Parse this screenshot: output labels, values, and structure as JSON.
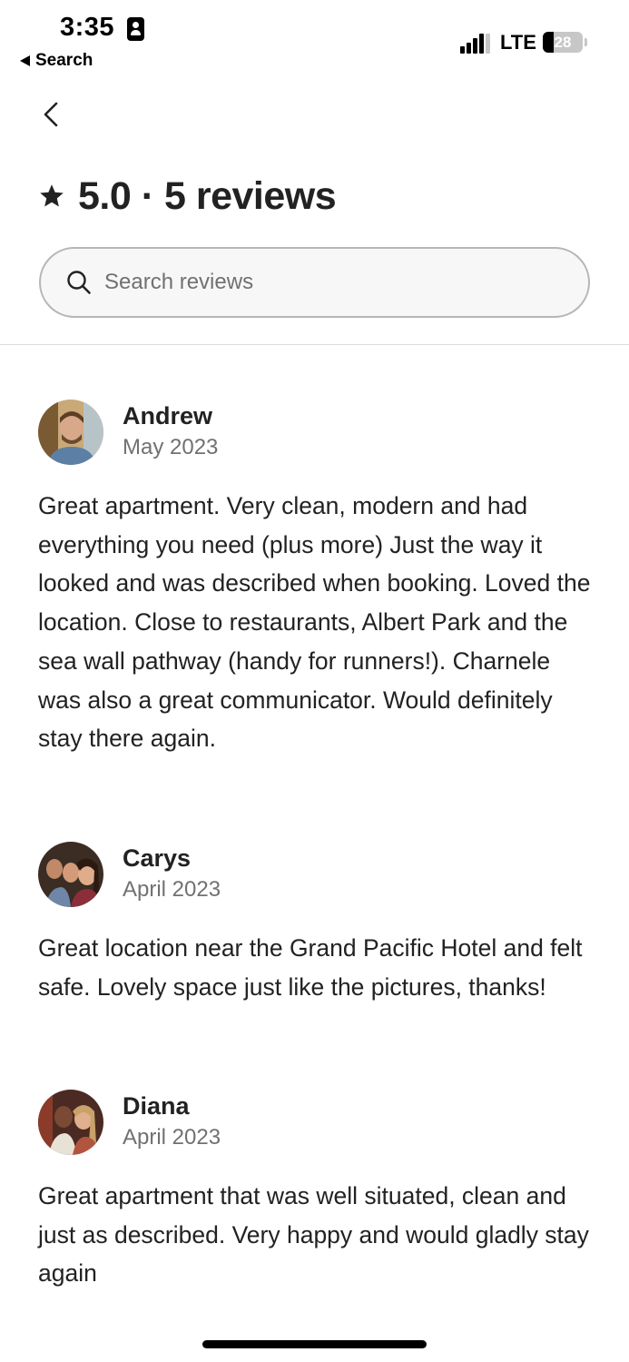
{
  "status_bar": {
    "time": "3:35",
    "back_app_label": "Search",
    "network": "LTE",
    "battery_percent": "28",
    "battery_level": 0.28
  },
  "header": {
    "rating": "5.0",
    "review_count_label": "5 reviews",
    "title": "5.0 · 5 reviews"
  },
  "search": {
    "placeholder": "Search reviews",
    "value": ""
  },
  "reviews": [
    {
      "name": "Andrew",
      "date": "May 2023",
      "text": "Great apartment. Very clean, modern and had everything you need (plus more) Just the way it looked and was described when booking. Loved the location. Close to  restaurants, Albert Park and the sea wall pathway (handy for runners!). Charnele was also a great communicator. Would definitely stay there again."
    },
    {
      "name": "Carys",
      "date": "April 2023",
      "text": "Great location near the Grand Pacific Hotel and felt safe. Lovely space just like the pictures, thanks!"
    },
    {
      "name": "Diana",
      "date": "April 2023",
      "text": "Great apartment that was well situated, clean and just as described.  Very happy and would gladly stay again"
    }
  ],
  "colors": {
    "text_primary": "#222222",
    "text_secondary": "#717171",
    "border": "#b6b6b6",
    "divider": "#dddddd"
  },
  "icons": [
    "badge-icon",
    "back-triangle-icon",
    "signal-icon",
    "battery-icon",
    "chevron-left-icon",
    "star-icon",
    "search-icon"
  ]
}
